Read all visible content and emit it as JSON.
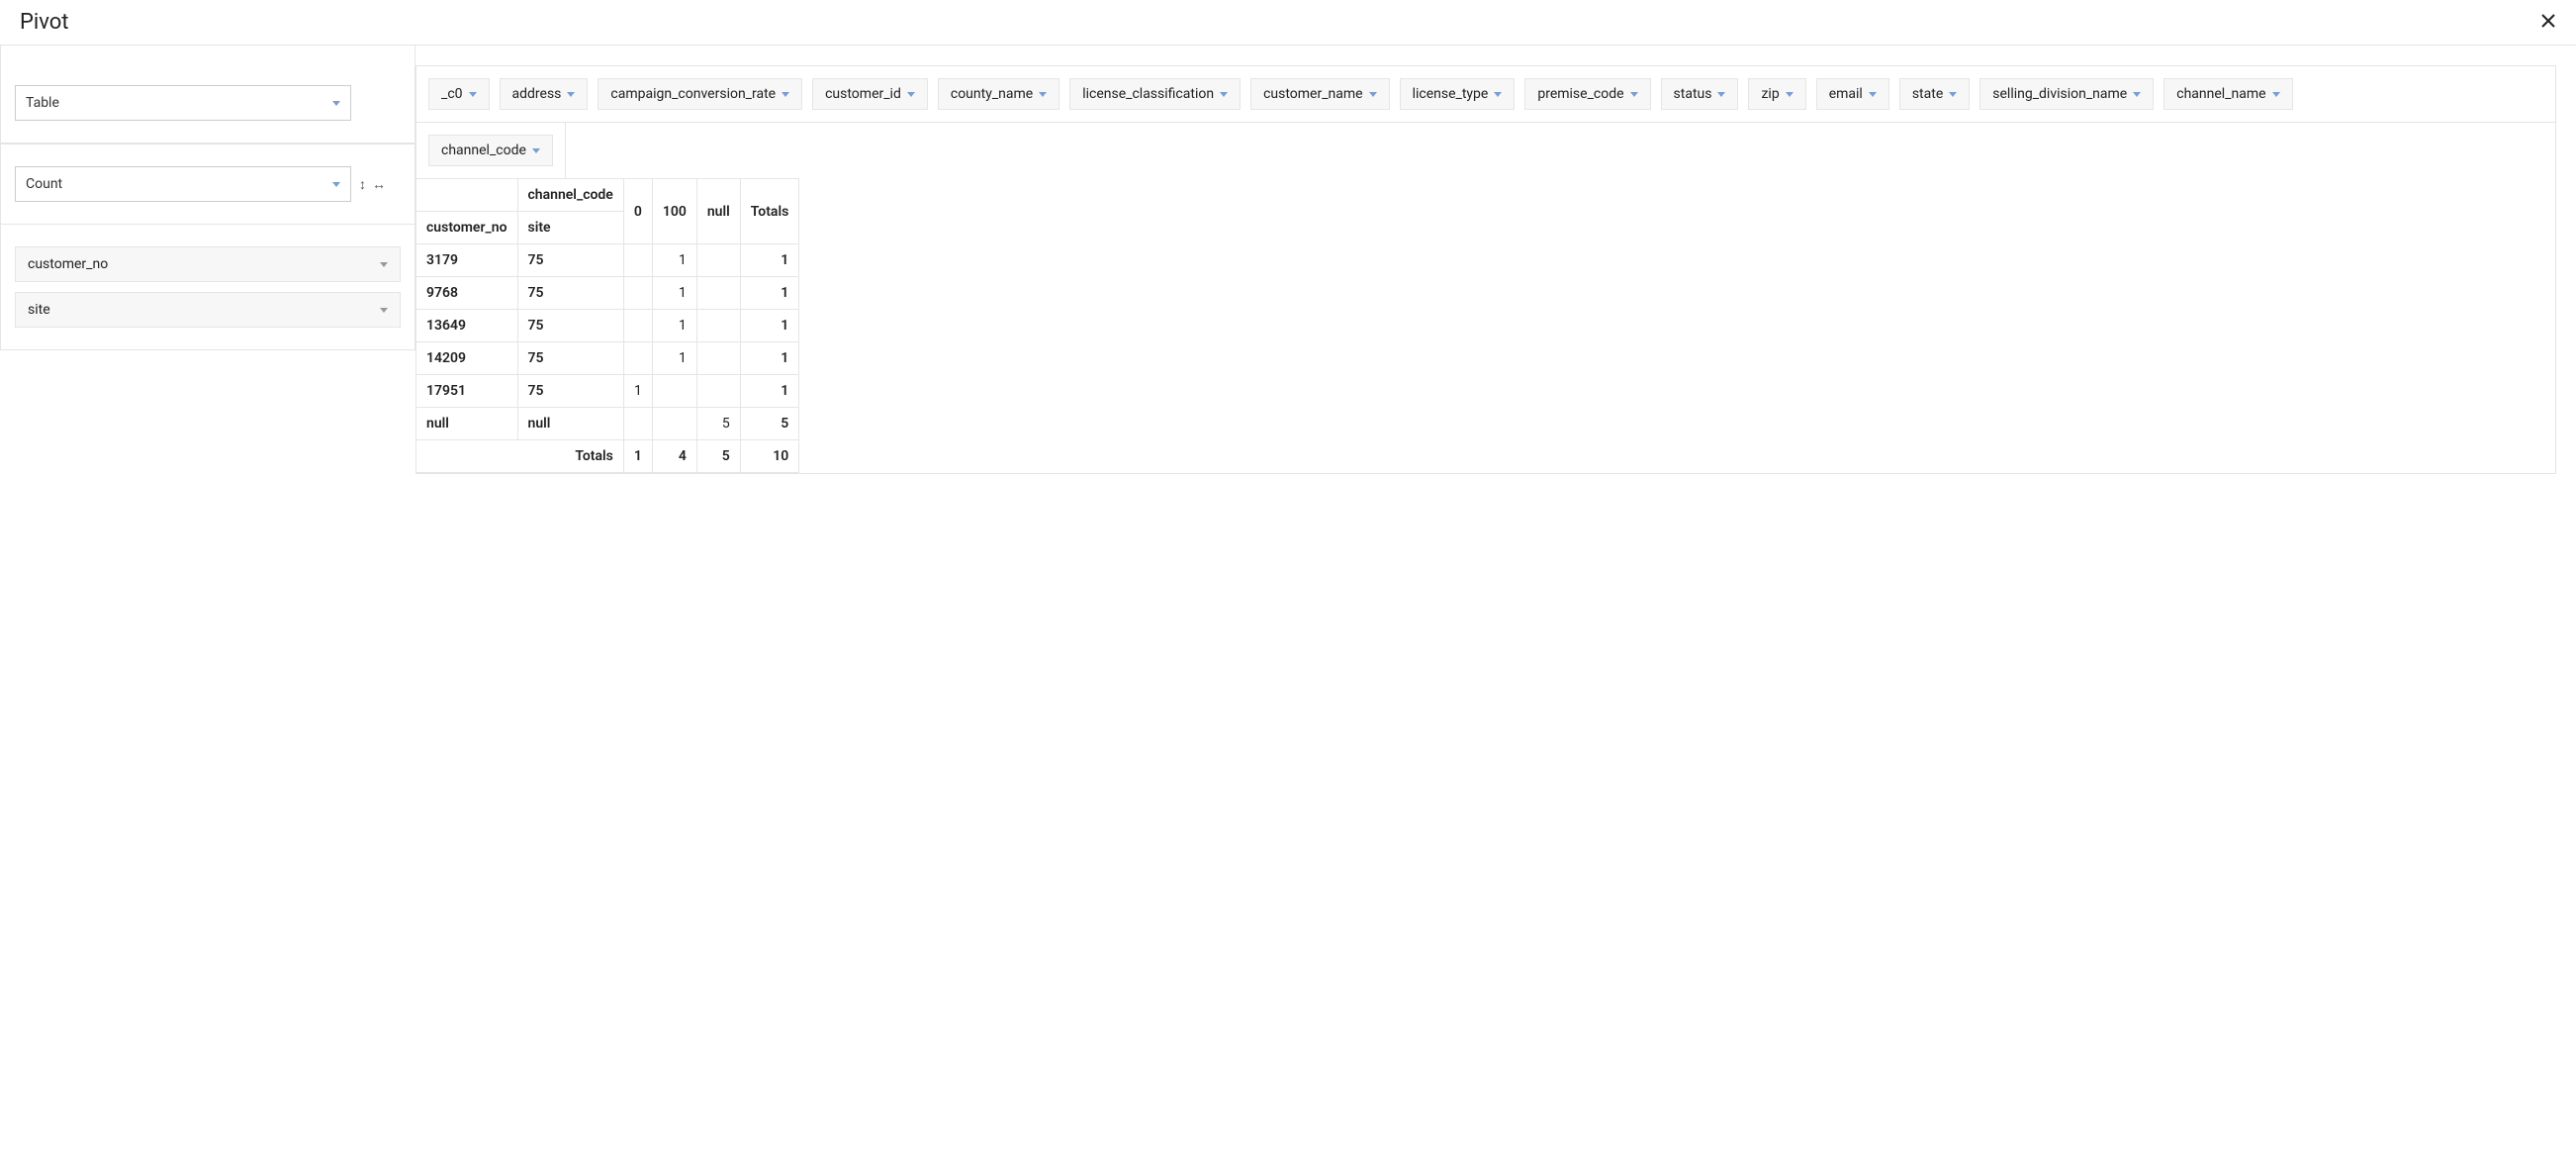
{
  "title": "Pivot",
  "renderer": {
    "selected": "Table"
  },
  "aggregator": {
    "selected": "Count"
  },
  "row_fields": [
    "customer_no",
    "site"
  ],
  "col_fields": [
    "channel_code"
  ],
  "unused_fields": [
    "_c0",
    "address",
    "campaign_conversion_rate",
    "customer_id",
    "county_name",
    "license_classification",
    "customer_name",
    "license_type",
    "premise_code",
    "status",
    "zip",
    "email",
    "state",
    "selling_division_name",
    "channel_name"
  ],
  "table": {
    "col_attr_label": "channel_code",
    "row_attr_labels": [
      "customer_no",
      "site"
    ],
    "col_values": [
      "0",
      "100",
      "null"
    ],
    "totals_label": "Totals",
    "rows": [
      {
        "keys": [
          "3179",
          "75"
        ],
        "cells": [
          "",
          "1",
          ""
        ],
        "total": "1"
      },
      {
        "keys": [
          "9768",
          "75"
        ],
        "cells": [
          "",
          "1",
          ""
        ],
        "total": "1"
      },
      {
        "keys": [
          "13649",
          "75"
        ],
        "cells": [
          "",
          "1",
          ""
        ],
        "total": "1"
      },
      {
        "keys": [
          "14209",
          "75"
        ],
        "cells": [
          "",
          "1",
          ""
        ],
        "total": "1"
      },
      {
        "keys": [
          "17951",
          "75"
        ],
        "cells": [
          "1",
          "",
          ""
        ],
        "total": "1"
      },
      {
        "keys": [
          "null",
          "null"
        ],
        "cells": [
          "",
          "",
          "5"
        ],
        "total": "5"
      }
    ],
    "col_totals": [
      "1",
      "4",
      "5"
    ],
    "grand_total": "10"
  }
}
